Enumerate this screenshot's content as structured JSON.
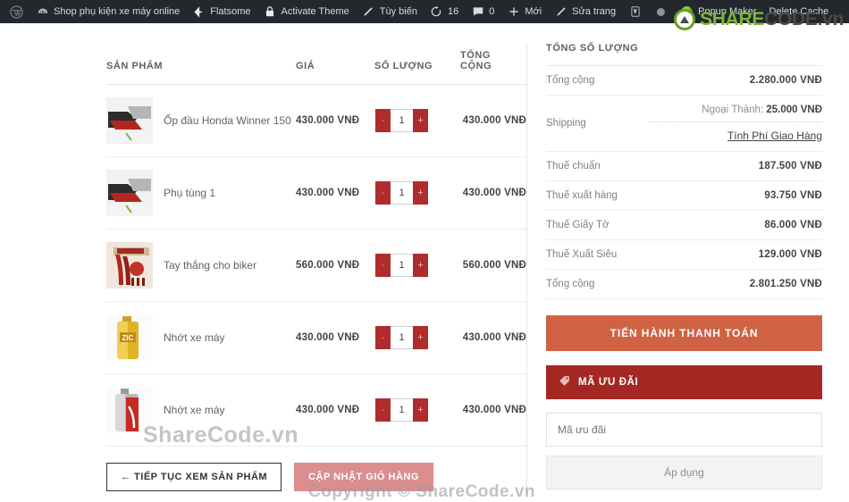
{
  "adminbar": {
    "items": [
      {
        "icon": "wordpress-logo-icon",
        "label": ""
      },
      {
        "icon": "dashboard-icon",
        "label": "Shop phụ kiện xe máy online"
      },
      {
        "icon": "flatsome-icon",
        "label": "Flatsome"
      },
      {
        "icon": "lock-icon",
        "label": "Activate Theme"
      },
      {
        "icon": "pencil-icon",
        "label": "Tùy biến"
      },
      {
        "icon": "updates-icon",
        "label": "16"
      },
      {
        "icon": "comment-icon",
        "label": "0"
      },
      {
        "icon": "plus-icon",
        "label": "Mới"
      },
      {
        "icon": "edit-page-icon",
        "label": "Sửa trang"
      },
      {
        "icon": "yoast-seo-icon",
        "label": ""
      },
      {
        "icon": "grey-dot-icon",
        "label": ""
      },
      {
        "icon": "popup-maker-icon",
        "label": "Popup Maker"
      },
      {
        "icon": "delete-cache-icon",
        "label": "Delete Cache"
      }
    ]
  },
  "brand": {
    "name_green": "SHARE",
    "name_dark": "CODE.vn",
    "logo_icon": "sharecode-recycle-logo-icon"
  },
  "cart": {
    "headers": {
      "product": "SẢN PHẨM",
      "price": "GIÁ",
      "quantity": "SỐ LƯỢNG",
      "total_line1": "TỔNG",
      "total_line2": "CỘNG"
    },
    "remove_icon": "remove-item-icon",
    "qty_minus": "-",
    "qty_plus": "+",
    "rows": [
      {
        "name": "Ốp đầu Honda Winner 150",
        "price": "430.000 VNĐ",
        "qty": "1",
        "total": "430.000 VNĐ",
        "thumb": "fairing-parts-photo"
      },
      {
        "name": "Phụ tùng 1",
        "price": "430.000 VNĐ",
        "qty": "1",
        "total": "430.000 VNĐ",
        "thumb": "fairing-parts-photo"
      },
      {
        "name": "Tay thắng cho biker",
        "price": "560.000 VNĐ",
        "qty": "1",
        "total": "560.000 VNĐ",
        "thumb": "brake-levers-photo"
      },
      {
        "name": "Nhớt xe máy",
        "price": "430.000 VNĐ",
        "qty": "1",
        "total": "430.000 VNĐ",
        "thumb": "zic-oil-bottle-photo"
      },
      {
        "name": "Nhớt xe máy",
        "price": "430.000 VNĐ",
        "qty": "1",
        "total": "430.000 VNĐ",
        "thumb": "red-oil-bottle-photo"
      }
    ],
    "actions": {
      "continue": "← TIẾP TỤC XEM SẢN PHẨM",
      "update": "CẬP NHẬT GIỎ HÀNG"
    }
  },
  "totals": {
    "title": "TỔNG SỐ LƯỢNG",
    "subtotal_label": "Tổng cộng",
    "subtotal_value": "2.280.000 VNĐ",
    "shipping_label": "Shipping",
    "shipping_rate_name": "Ngoại Thành:",
    "shipping_rate_value": "25.000 VNĐ",
    "shipping_calc_link": "Tính Phí Giao Hàng",
    "taxes": [
      {
        "label": "Thuế chuẩn",
        "value": "187.500 VNĐ"
      },
      {
        "label": "Thuế xuất hàng",
        "value": "93.750 VNĐ"
      },
      {
        "label": "Thuế Giấy Tờ",
        "value": "86.000 VNĐ"
      },
      {
        "label": "Thuế Xuất Siêu",
        "value": "129.000 VNĐ"
      }
    ],
    "grand_label": "Tổng cộng",
    "grand_value": "2.801.250 VNĐ",
    "checkout_button": "TIẾN HÀNH THANH TOÁN",
    "coupon_header": "MÃ ƯU ĐÃI",
    "coupon_icon": "coupon-tag-icon",
    "coupon_placeholder": "Mã ưu đãi",
    "coupon_value": "",
    "coupon_apply": "Áp dụng"
  },
  "watermarks": {
    "sharecode": "ShareCode.vn",
    "copyright": "Copyright © ShareCode.vn"
  },
  "colors": {
    "adminbar_bg": "#23282d",
    "qty_button": "#b02b2b",
    "checkout_button": "#cf6243",
    "coupon_header": "#a52724",
    "update_button": "#dc8d8d",
    "brand_green": "#7fb539"
  }
}
